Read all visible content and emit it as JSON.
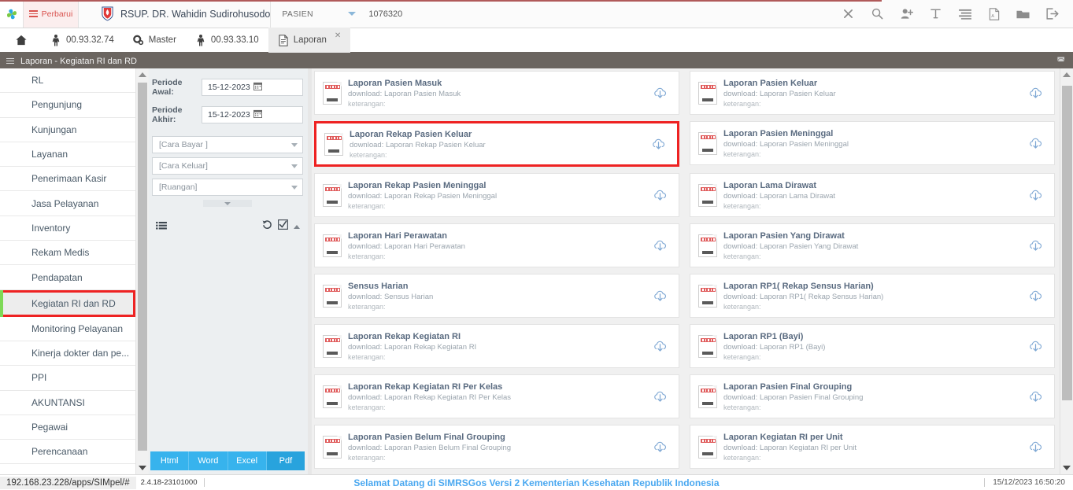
{
  "header": {
    "refresh_label": "Perbarui",
    "hospital_name": "RSUP. DR. Wahidin Sudirohusodo",
    "context_label": "PASIEN",
    "context_value": "1076320",
    "icons": [
      "close-icon",
      "search-icon",
      "add-user-icon",
      "text-format-icon",
      "list-icon",
      "pdf-icon",
      "folder-icon",
      "logout-icon"
    ]
  },
  "tabs": [
    {
      "label": "",
      "icon": "home-icon",
      "active": false
    },
    {
      "label": "00.93.32.74",
      "icon": "person-icon",
      "active": false
    },
    {
      "label": "Master",
      "icon": "gears-icon",
      "active": false
    },
    {
      "label": "00.93.33.10",
      "icon": "person-icon",
      "active": false
    },
    {
      "label": "Laporan",
      "icon": "document-icon",
      "active": true
    }
  ],
  "page": {
    "title": "Laporan - Kegiatan RI dan RD",
    "expand_icon": "expand-icon"
  },
  "sidebar": {
    "items": [
      {
        "label": "RL",
        "selected": false
      },
      {
        "label": "Pengunjung",
        "selected": false
      },
      {
        "label": "Kunjungan",
        "selected": false
      },
      {
        "label": "Layanan",
        "selected": false
      },
      {
        "label": "Penerimaan Kasir",
        "selected": false
      },
      {
        "label": "Jasa Pelayanan",
        "selected": false
      },
      {
        "label": "Inventory",
        "selected": false
      },
      {
        "label": "Rekam Medis",
        "selected": false
      },
      {
        "label": "Pendapatan",
        "selected": false
      },
      {
        "label": "Kegiatan RI dan RD",
        "selected": true
      },
      {
        "label": "Monitoring Pelayanan",
        "selected": false
      },
      {
        "label": "Kinerja dokter dan pe...",
        "selected": false
      },
      {
        "label": "PPI",
        "selected": false
      },
      {
        "label": "AKUNTANSI",
        "selected": false
      },
      {
        "label": "Pegawai",
        "selected": false
      },
      {
        "label": "Perencanaan",
        "selected": false
      }
    ]
  },
  "filters": {
    "periode_awal_label": "Periode Awal:",
    "periode_awal_value": "15-12-2023",
    "periode_akhir_label": "Periode Akhir:",
    "periode_akhir_value": "15-12-2023",
    "selects": [
      {
        "placeholder": "[Cara Bayar ]"
      },
      {
        "placeholder": "[Cara Keluar]"
      },
      {
        "placeholder": "[Ruangan]"
      }
    ],
    "export_buttons": [
      {
        "label": "Html",
        "active": false
      },
      {
        "label": "Word",
        "active": false
      },
      {
        "label": "Excel",
        "active": false
      },
      {
        "label": "Pdf",
        "active": true
      }
    ]
  },
  "reports": {
    "download_prefix": "download: ",
    "keterangan_label": "keterangan:",
    "items": [
      {
        "title": "Laporan Pasien Masuk",
        "download": "download: Laporan Pasien Masuk",
        "keterangan": "keterangan:",
        "highlight": false
      },
      {
        "title": "Laporan Pasien Keluar",
        "download": "download: Laporan Pasien Keluar",
        "keterangan": "keterangan:",
        "highlight": false
      },
      {
        "title": "Laporan Rekap Pasien Keluar",
        "download": "download: Laporan Rekap Pasien Keluar",
        "keterangan": "keterangan:",
        "highlight": true
      },
      {
        "title": "Laporan Pasien Meninggal",
        "download": "download: Laporan Pasien Meninggal",
        "keterangan": "keterangan:",
        "highlight": false
      },
      {
        "title": "Laporan Rekap Pasien Meninggal",
        "download": "download: Laporan Rekap Pasien Meninggal",
        "keterangan": "keterangan:",
        "highlight": false
      },
      {
        "title": "Laporan Lama Dirawat",
        "download": "download: Laporan Lama Dirawat",
        "keterangan": "keterangan:",
        "highlight": false
      },
      {
        "title": "Laporan Hari Perawatan",
        "download": "download: Laporan Hari Perawatan",
        "keterangan": "keterangan:",
        "highlight": false
      },
      {
        "title": "Laporan Pasien Yang Dirawat",
        "download": "download: Laporan Pasien Yang Dirawat",
        "keterangan": "keterangan:",
        "highlight": false
      },
      {
        "title": "Sensus Harian",
        "download": "download: Sensus Harian",
        "keterangan": "keterangan:",
        "highlight": false
      },
      {
        "title": "Laporan RP1( Rekap Sensus Harian)",
        "download": "download: Laporan RP1( Rekap Sensus Harian)",
        "keterangan": "keterangan:",
        "highlight": false
      },
      {
        "title": "Laporan Rekap Kegiatan RI",
        "download": "download: Laporan Rekap Kegiatan RI",
        "keterangan": "keterangan:",
        "highlight": false
      },
      {
        "title": "Laporan RP1 (Bayi)",
        "download": "download: Laporan RP1 (Bayi)",
        "keterangan": "keterangan:",
        "highlight": false
      },
      {
        "title": "Laporan Rekap Kegiatan RI Per Kelas",
        "download": "download: Laporan Rekap Kegiatan RI Per Kelas",
        "keterangan": "keterangan:",
        "highlight": false
      },
      {
        "title": "Laporan Pasien Final Grouping",
        "download": "download: Laporan Pasien Final Grouping",
        "keterangan": "keterangan:",
        "highlight": false
      },
      {
        "title": "Laporan Pasien Belum Final Grouping",
        "download": "download: Laporan Pasien Belum Final Grouping",
        "keterangan": "keterangan:",
        "highlight": false
      },
      {
        "title": "Laporan Kegiatan RI per Unit",
        "download": "download: Laporan Kegiatan RI per Unit",
        "keterangan": "keterangan:",
        "highlight": false
      }
    ]
  },
  "status": {
    "url": "192.168.23.228/apps/SIMpel/#",
    "version": "2.4.18-23101000",
    "welcome": "Selamat Datang di SIMRSGos Versi 2 Kementerian Kesehatan Republik Indonesia",
    "datetime": "15/12/2023 16:50:20"
  },
  "colors": {
    "accent_blue": "#37b3ed",
    "highlight_red": "#ee2222",
    "titlebar_gray": "#6b6560",
    "welcome_blue": "#4aa8f0"
  }
}
